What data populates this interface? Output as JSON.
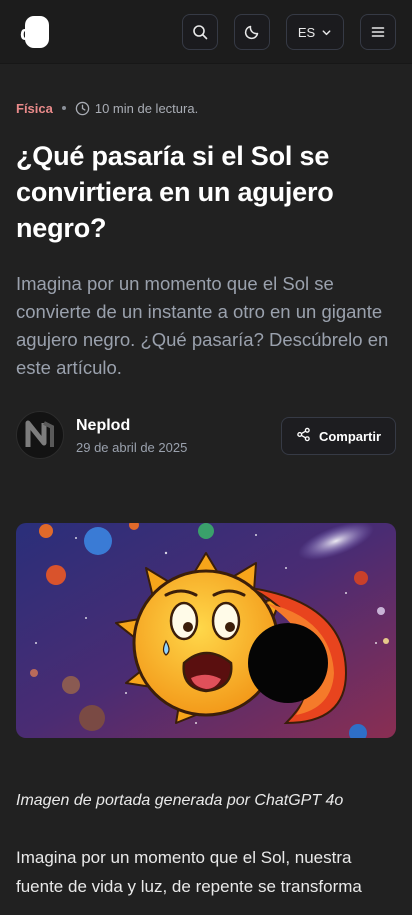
{
  "header": {
    "logo_text": "dC",
    "language_label": "ES",
    "search_icon": "search-icon",
    "theme_icon": "moon-icon",
    "menu_icon": "menu-icon"
  },
  "article": {
    "category": "Física",
    "read_time": "10 min de lectura.",
    "title": "¿Qué pasaría si el Sol se convirtiera en un agujero negro?",
    "lead": "Imagina por un momento que el Sol se convierte de un instante a otro en un gigante agujero negro. ¿Qué pasaría? Descúbrelo en este artículo.",
    "author": {
      "name": "Neplod",
      "date": "29 de abril de 2025"
    },
    "share_label": "Compartir",
    "image_caption": "Imagen de portada generada por ChatGPT 4o",
    "body_first_paragraph": "Imagina por un momento que el Sol, nuestra fuente de vida y luz, de repente se transforma"
  },
  "colors": {
    "background": "#212121",
    "category": "#e98a8a",
    "muted_text": "#9aa1ad"
  }
}
